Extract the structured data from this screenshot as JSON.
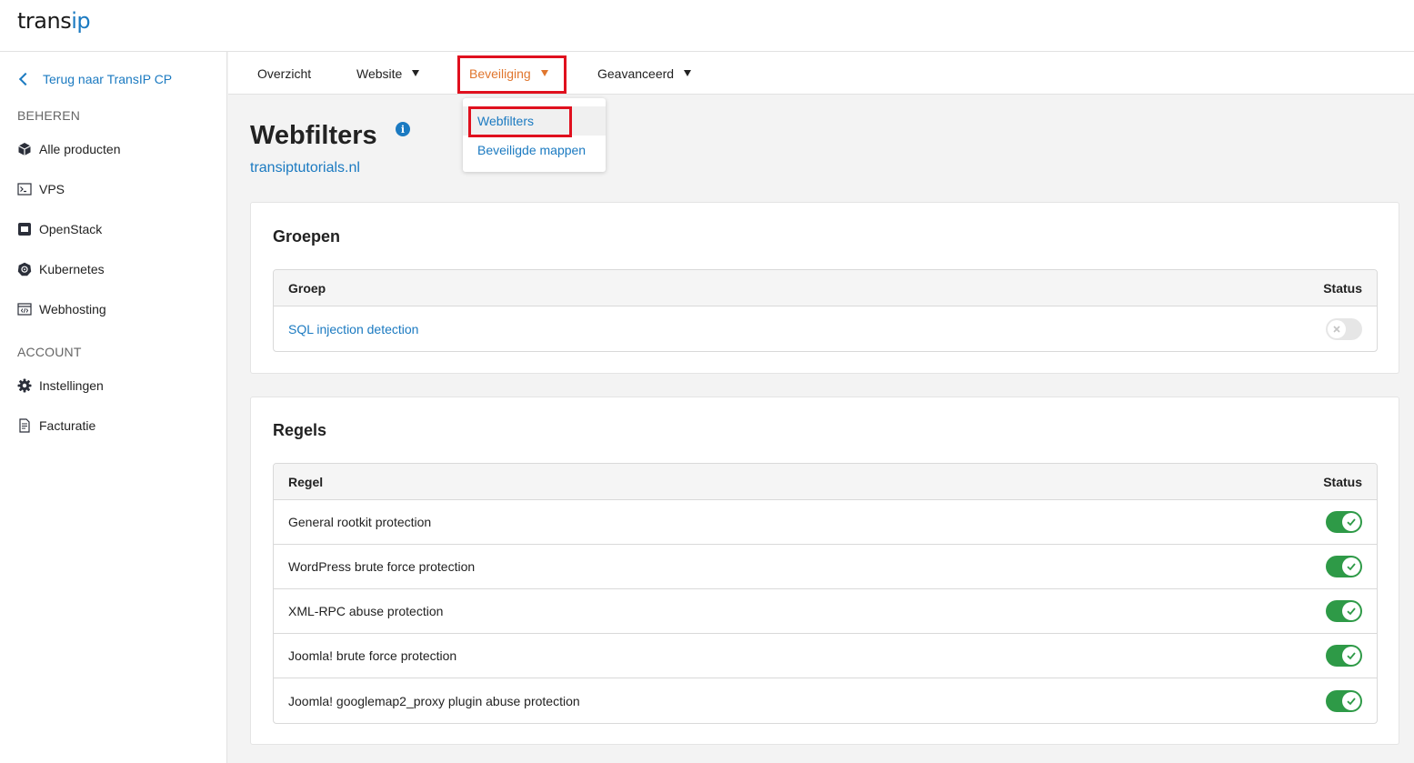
{
  "brand": {
    "logo_part1": "trans",
    "logo_part2": "ip"
  },
  "sidebar": {
    "back_label": "Terug naar TransIP CP",
    "section_manage": "BEHEREN",
    "section_account": "ACCOUNT",
    "items": [
      {
        "label": "Alle producten",
        "icon": "cube-icon"
      },
      {
        "label": "VPS",
        "icon": "terminal-icon"
      },
      {
        "label": "OpenStack",
        "icon": "openstack-icon"
      },
      {
        "label": "Kubernetes",
        "icon": "kubernetes-icon"
      },
      {
        "label": "Webhosting",
        "icon": "webhosting-icon"
      }
    ],
    "account_items": [
      {
        "label": "Instellingen",
        "icon": "gear-icon"
      },
      {
        "label": "Facturatie",
        "icon": "invoice-icon"
      }
    ]
  },
  "tabs": [
    {
      "label": "Overzicht",
      "has_menu": false
    },
    {
      "label": "Website",
      "has_menu": true
    },
    {
      "label": "Beveiliging",
      "has_menu": true,
      "active": true
    },
    {
      "label": "Geavanceerd",
      "has_menu": true
    }
  ],
  "dropdown": {
    "items": [
      {
        "label": "Webfilters"
      },
      {
        "label": "Beveiligde mappen"
      }
    ]
  },
  "page": {
    "title": "Webfilters",
    "domain": "transiptutorials.nl"
  },
  "groups_card": {
    "title": "Groepen",
    "col_name": "Groep",
    "col_status": "Status",
    "rows": [
      {
        "name": "SQL injection detection",
        "enabled": false
      }
    ]
  },
  "rules_card": {
    "title": "Regels",
    "col_name": "Regel",
    "col_status": "Status",
    "rows": [
      {
        "name": "General rootkit protection",
        "enabled": true
      },
      {
        "name": "WordPress brute force protection",
        "enabled": true
      },
      {
        "name": "XML-RPC abuse protection",
        "enabled": true
      },
      {
        "name": "Joomla! brute force protection",
        "enabled": true
      },
      {
        "name": "Joomla! googlemap2_proxy plugin abuse protection",
        "enabled": true
      }
    ]
  },
  "colors": {
    "link": "#1b7ac1",
    "active_tab": "#e0762e",
    "highlight": "#e0101e",
    "toggle_on": "#2e9a47",
    "toggle_off": "#e6e6e6"
  }
}
